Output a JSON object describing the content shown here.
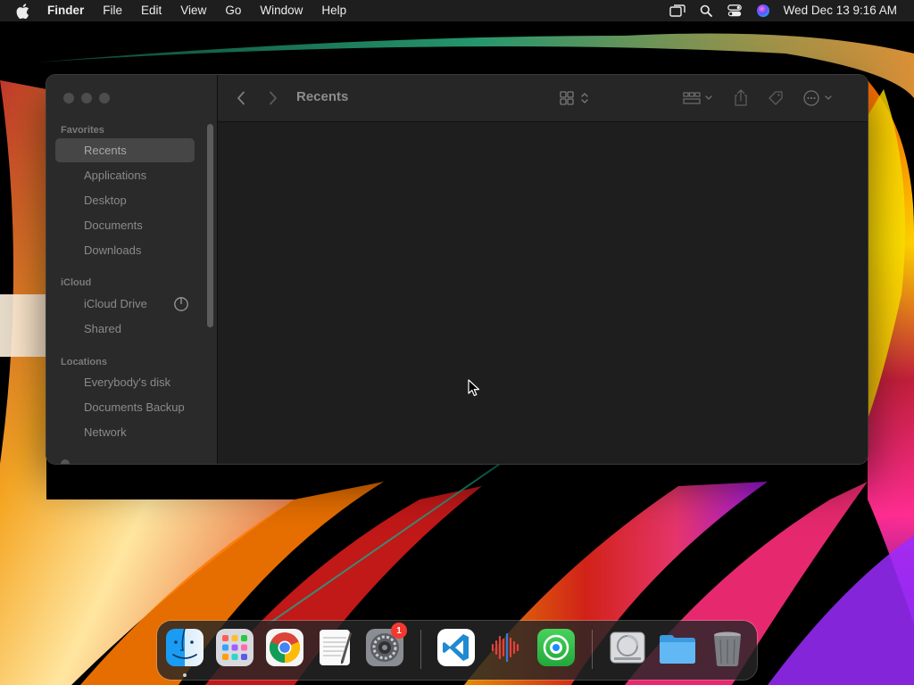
{
  "menubar": {
    "app_name": "Finder",
    "menus": [
      "File",
      "Edit",
      "View",
      "Go",
      "Window",
      "Help"
    ],
    "clock": "Wed Dec 13  9:16 AM"
  },
  "finder": {
    "title": "Recents",
    "sidebar": {
      "sections": {
        "favorites": "Favorites",
        "icloud": "iCloud",
        "locations": "Locations"
      },
      "favorites": [
        "Recents",
        "Applications",
        "Desktop",
        "Documents",
        "Downloads"
      ],
      "icloud": [
        "iCloud Drive",
        "Shared"
      ],
      "locations": [
        "Everybody's disk",
        "Documents Backup",
        "Network"
      ]
    }
  },
  "dock": {
    "apps": [
      "finder",
      "launchpad",
      "chrome",
      "textedit",
      "system-settings",
      "vscode",
      "audio-app",
      "find-my",
      "disk-image",
      "folder",
      "trash"
    ],
    "settings_badge": "1"
  },
  "colors": {
    "window_bg": "#1e1e1e",
    "sidebar_bg": "#2a2a2a",
    "selected_row": "#464646",
    "badge": "#f2392f"
  }
}
